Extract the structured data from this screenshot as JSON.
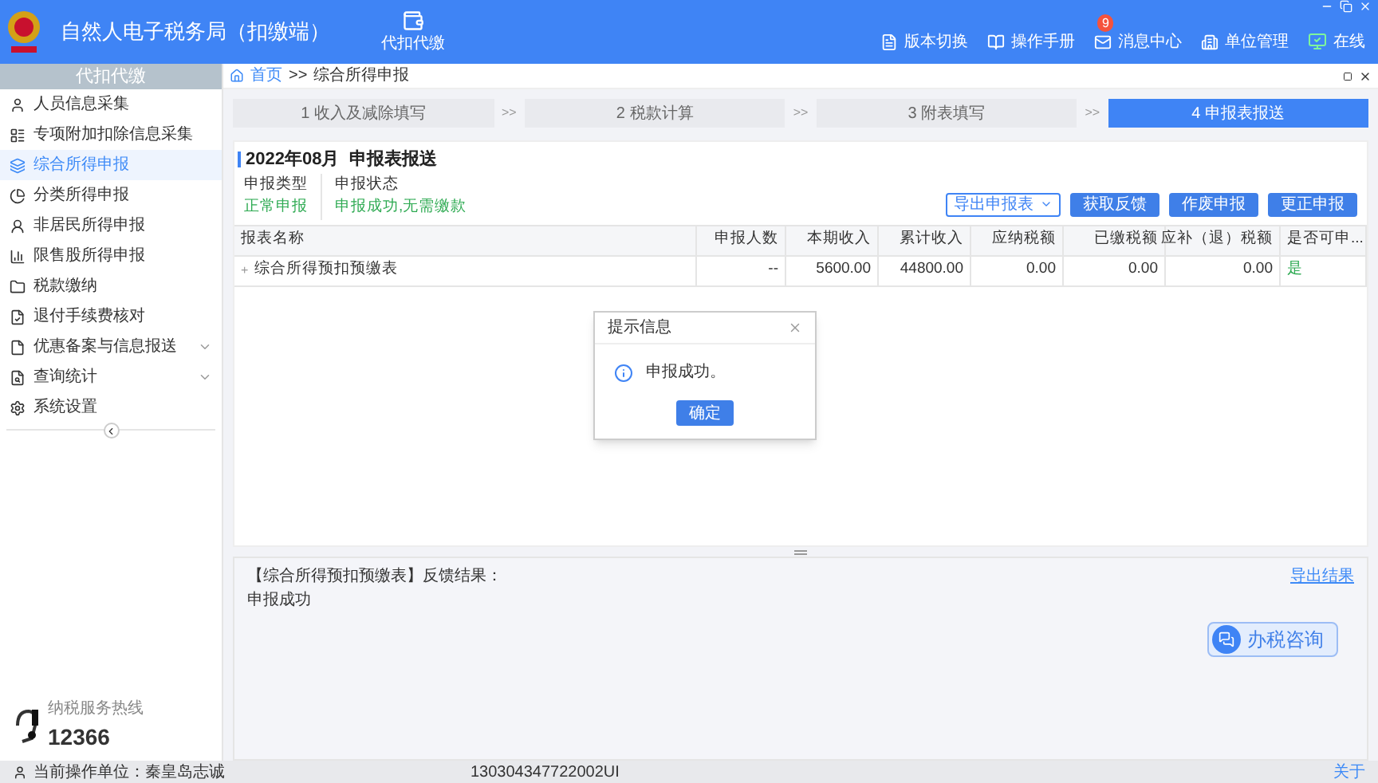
{
  "header": {
    "title": "自然人电子税务局（扣缴端）",
    "module": "代扣代缴",
    "actions": [
      {
        "kind": "version",
        "label": "版本切换"
      },
      {
        "kind": "manual",
        "label": "操作手册"
      },
      {
        "kind": "message",
        "label": "消息中心",
        "badge": "9"
      },
      {
        "kind": "unit",
        "label": "单位管理"
      }
    ],
    "online": "在线"
  },
  "sidebar": {
    "heading": "代扣代缴",
    "items": [
      {
        "kind": "person",
        "label": "人员信息采集",
        "selected": false,
        "expandable": false
      },
      {
        "kind": "list",
        "label": "专项附加扣除信息采集",
        "selected": false,
        "expandable": false
      },
      {
        "kind": "layers",
        "label": "综合所得申报",
        "selected": true,
        "expandable": false
      },
      {
        "kind": "pie",
        "label": "分类所得申报",
        "selected": false,
        "expandable": false
      },
      {
        "kind": "user",
        "label": "非居民所得申报",
        "selected": false,
        "expandable": false
      },
      {
        "kind": "chart",
        "label": "限售股所得申报",
        "selected": false,
        "expandable": false
      },
      {
        "kind": "folder",
        "label": "税款缴纳",
        "selected": false,
        "expandable": false
      },
      {
        "kind": "check",
        "label": "退付手续费核对",
        "selected": false,
        "expandable": false
      },
      {
        "kind": "file",
        "label": "优惠备案与信息报送",
        "selected": false,
        "expandable": true
      },
      {
        "kind": "search",
        "label": "查询统计",
        "selected": false,
        "expandable": true
      },
      {
        "kind": "settings",
        "label": "系统设置",
        "selected": false,
        "expandable": false
      }
    ],
    "hotline_label": "纳税服务热线",
    "hotline_number": "12366"
  },
  "breadcrumb": {
    "home": "首页",
    "separator": ">>",
    "current": "综合所得申报"
  },
  "steps": [
    {
      "label": "1 收入及减除填写",
      "selected": false
    },
    {
      "separator": ">>",
      "label": "2 税款计算",
      "selected": false
    },
    {
      "separator": ">>",
      "label": "3 附表填写",
      "selected": false
    },
    {
      "separator": ">>",
      "label": "4 申报表报送",
      "selected": true
    }
  ],
  "report": {
    "title": "2022年08月  申报表报送",
    "info": [
      {
        "label": "申报类型",
        "value": "正常申报"
      },
      {
        "label": "申报状态",
        "value": "申报成功,无需缴款"
      }
    ],
    "buttons": [
      {
        "kind": "dropdown",
        "label": "导出申报表"
      },
      {
        "kind": "primary",
        "label": "获取反馈"
      },
      {
        "kind": "primary",
        "label": "作废申报"
      },
      {
        "kind": "primary",
        "label": "更正申报"
      }
    ],
    "table": {
      "columns": [
        "报表名称",
        "申报人数",
        "本期收入",
        "累计收入",
        "应纳税额",
        "已缴税额",
        "应补（退）税额",
        "是否可申..."
      ],
      "rows": [
        {
          "expander": "+",
          "cells": [
            "综合所得预扣预缴表",
            "--",
            "5600.00",
            "44800.00",
            "0.00",
            "0.00",
            "0.00",
            "是"
          ]
        }
      ]
    }
  },
  "dialog": {
    "title": "提示信息",
    "message": "申报成功。",
    "button": "确定"
  },
  "feedback": {
    "heading": "【综合所得预扣预缴表】反馈结果：",
    "result": "申报成功",
    "export_link": "导出结果",
    "consult": "办税咨询"
  },
  "status_bar": {
    "unit": "当前操作单位：秦皇岛志诚",
    "code": "130304347722002UI",
    "about": "关于"
  }
}
